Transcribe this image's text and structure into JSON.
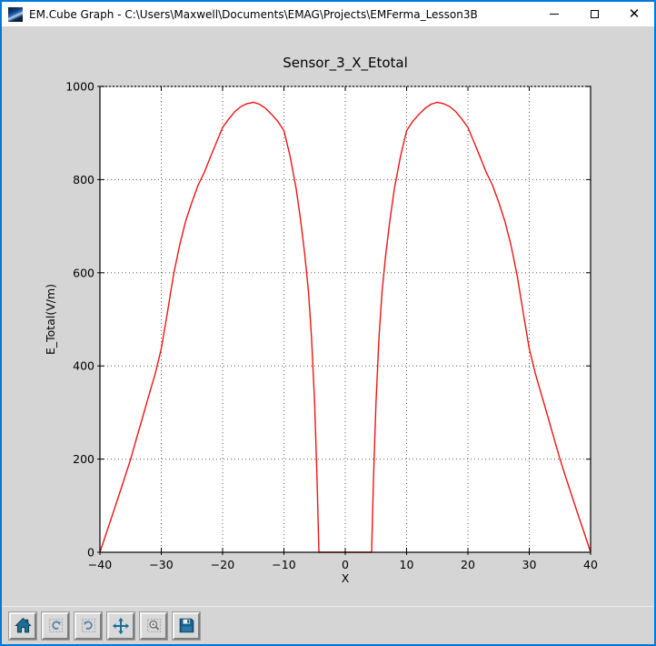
{
  "window": {
    "title": "EM.Cube Graph - C:\\Users\\Maxwell\\Documents\\EMAG\\Projects\\EMFerma_Lesson3B",
    "controls": [
      "minimize-icon",
      "maximize-icon",
      "close-icon"
    ],
    "border_color": "#0079d8"
  },
  "toolbar": {
    "buttons": [
      "home-icon",
      "back-icon",
      "forward-icon",
      "pan-icon",
      "zoom-rect-icon",
      "save-icon"
    ],
    "icon_color": "#1e6f93"
  },
  "chart_data": {
    "type": "line",
    "title": "Sensor_3_X_Etotal",
    "xlabel": "X",
    "ylabel": "E_Total(V/m)",
    "xlim": [
      -40,
      40
    ],
    "ylim": [
      0,
      1000
    ],
    "xticks": [
      -40,
      -30,
      -20,
      -10,
      0,
      10,
      20,
      30,
      40
    ],
    "yticks": [
      0,
      200,
      400,
      600,
      800,
      1000
    ],
    "grid": true,
    "grid_style": "dotted",
    "plot_bg": "#ffffff",
    "figure_bg": "#d5d5d5",
    "legend": "none",
    "series": [
      {
        "name": "E_Total",
        "color": "#f01414",
        "x": [
          -40,
          -39,
          -38,
          -37,
          -36,
          -35,
          -34,
          -33,
          -32,
          -31,
          -30,
          -29,
          -28,
          -27,
          -26,
          -25,
          -24,
          -23,
          -22,
          -21,
          -20,
          -19,
          -18,
          -17,
          -16,
          -15,
          -14,
          -13,
          -12,
          -11,
          -10,
          -9,
          -8,
          -7.3,
          -6.6,
          -6,
          -5.5,
          -5,
          -4.6,
          -4.3,
          0,
          4.3,
          4.6,
          5,
          5.5,
          6,
          6.6,
          7.3,
          8,
          9,
          10,
          11,
          12,
          13,
          14,
          15,
          16,
          17,
          18,
          19,
          20,
          21,
          22,
          23,
          24,
          25,
          26,
          27,
          28,
          29,
          30,
          31,
          32,
          33,
          34,
          35,
          36,
          37,
          38,
          39,
          40
        ],
        "y": [
          0,
          40,
          79,
          119,
          159,
          200,
          246,
          292,
          338,
          383,
          437,
          515,
          596,
          660,
          712,
          752,
          788,
          815,
          848,
          880,
          912,
          930,
          946,
          957,
          963,
          966,
          962,
          953,
          940,
          925,
          905,
          850,
          780,
          715,
          640,
          560,
          460,
          320,
          160,
          0,
          0,
          0,
          160,
          320,
          460,
          560,
          640,
          715,
          780,
          850,
          905,
          925,
          940,
          953,
          962,
          966,
          963,
          957,
          946,
          930,
          912,
          880,
          848,
          815,
          788,
          752,
          712,
          660,
          596,
          515,
          437,
          383,
          338,
          292,
          246,
          200,
          159,
          119,
          79,
          40,
          0
        ]
      }
    ]
  }
}
